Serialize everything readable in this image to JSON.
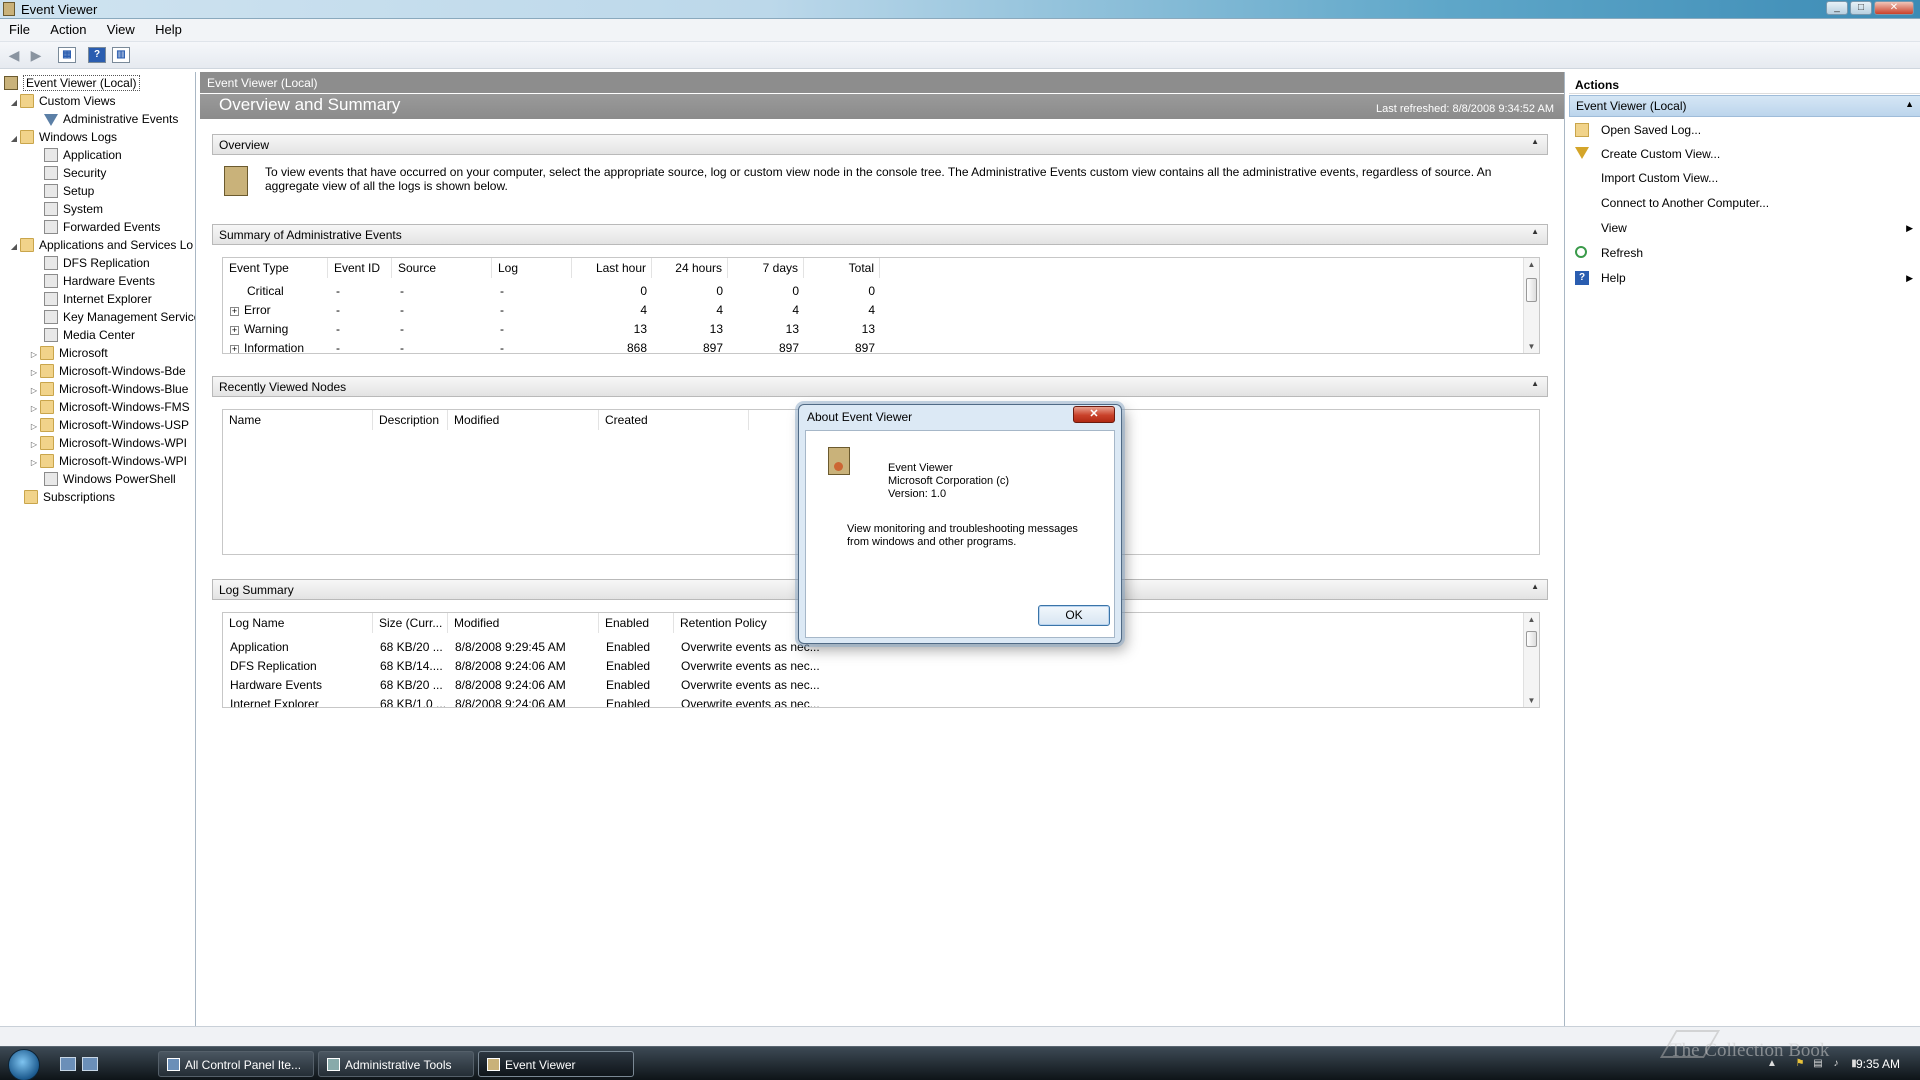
{
  "window": {
    "title": "Event Viewer"
  },
  "menu": [
    "File",
    "Action",
    "View",
    "Help"
  ],
  "tree": {
    "root": "Event Viewer (Local)",
    "custom_views": "Custom Views",
    "administrative_events": "Administrative Events",
    "windows_logs": "Windows Logs",
    "logs": [
      "Application",
      "Security",
      "Setup",
      "System",
      "Forwarded Events"
    ],
    "app_services": "Applications and Services Lo",
    "app_items": [
      "DFS Replication",
      "Hardware Events",
      "Internet Explorer",
      "Key Management Service",
      "Media Center"
    ],
    "folders": [
      "Microsoft",
      "Microsoft-Windows-Bde",
      "Microsoft-Windows-Blue",
      "Microsoft-Windows-FMS",
      "Microsoft-Windows-USP",
      "Microsoft-Windows-WPI",
      "Microsoft-Windows-WPI"
    ],
    "powershell": "Windows PowerShell",
    "subscriptions": "Subscriptions"
  },
  "center": {
    "header": "Event Viewer (Local)",
    "title": "Overview and Summary",
    "last_refreshed": "Last refreshed: 8/8/2008 9:34:52 AM",
    "overview": {
      "heading": "Overview",
      "text1": "To view events that have occurred on your computer, select the appropriate source, log or custom view node in the console tree. The Administrative Events custom view contains all the administrative events, regardless of source. An",
      "text2": "aggregate view of all the logs is shown below."
    },
    "summary": {
      "heading": "Summary of Administrative Events",
      "columns": [
        "Event Type",
        "Event ID",
        "Source",
        "Log",
        "Last hour",
        "24 hours",
        "7 days",
        "Total"
      ],
      "rows": [
        {
          "type": "Critical",
          "id": "-",
          "source": "-",
          "log": "-",
          "hour": "0",
          "day": "0",
          "week": "0",
          "total": "0"
        },
        {
          "type": "Error",
          "id": "-",
          "source": "-",
          "log": "-",
          "hour": "4",
          "day": "4",
          "week": "4",
          "total": "4"
        },
        {
          "type": "Warning",
          "id": "-",
          "source": "-",
          "log": "-",
          "hour": "13",
          "day": "13",
          "week": "13",
          "total": "13"
        },
        {
          "type": "Information",
          "id": "-",
          "source": "-",
          "log": "-",
          "hour": "868",
          "day": "897",
          "week": "897",
          "total": "897"
        }
      ]
    },
    "recent": {
      "heading": "Recently Viewed Nodes",
      "columns": [
        "Name",
        "Description",
        "Modified",
        "Created"
      ]
    },
    "logsummary": {
      "heading": "Log Summary",
      "columns": [
        "Log Name",
        "Size (Curr...",
        "Modified",
        "Enabled",
        "Retention Policy"
      ],
      "rows": [
        {
          "name": "Application",
          "size": "68 KB/20 ...",
          "modified": "8/8/2008 9:29:45 AM",
          "enabled": "Enabled",
          "policy": "Overwrite events as nec..."
        },
        {
          "name": "DFS Replication",
          "size": "68 KB/14....",
          "modified": "8/8/2008 9:24:06 AM",
          "enabled": "Enabled",
          "policy": "Overwrite events as nec..."
        },
        {
          "name": "Hardware Events",
          "size": "68 KB/20 ...",
          "modified": "8/8/2008 9:24:06 AM",
          "enabled": "Enabled",
          "policy": "Overwrite events as nec..."
        },
        {
          "name": "Internet Explorer",
          "size": "68 KB/1.0 ...",
          "modified": "8/8/2008 9:24:06 AM",
          "enabled": "Enabled",
          "policy": "Overwrite events as nec..."
        }
      ]
    }
  },
  "actions": {
    "heading": "Actions",
    "section": "Event Viewer (Local)",
    "items": [
      "Open Saved Log...",
      "Create Custom View...",
      "Import Custom View...",
      "Connect to Another Computer...",
      "View",
      "Refresh",
      "Help"
    ]
  },
  "dialog": {
    "title": "About Event Viewer",
    "app": "Event Viewer",
    "company": "Microsoft Corporation (c)",
    "version": "Version: 1.0",
    "desc1": "View monitoring and troubleshooting messages",
    "desc2": "from windows and other programs.",
    "ok": "OK"
  },
  "taskbar": {
    "tasks": [
      "All Control Panel Ite...",
      "Administrative Tools",
      "Event Viewer"
    ],
    "clock": "9:35 AM"
  },
  "watermark": "The Collection Book"
}
